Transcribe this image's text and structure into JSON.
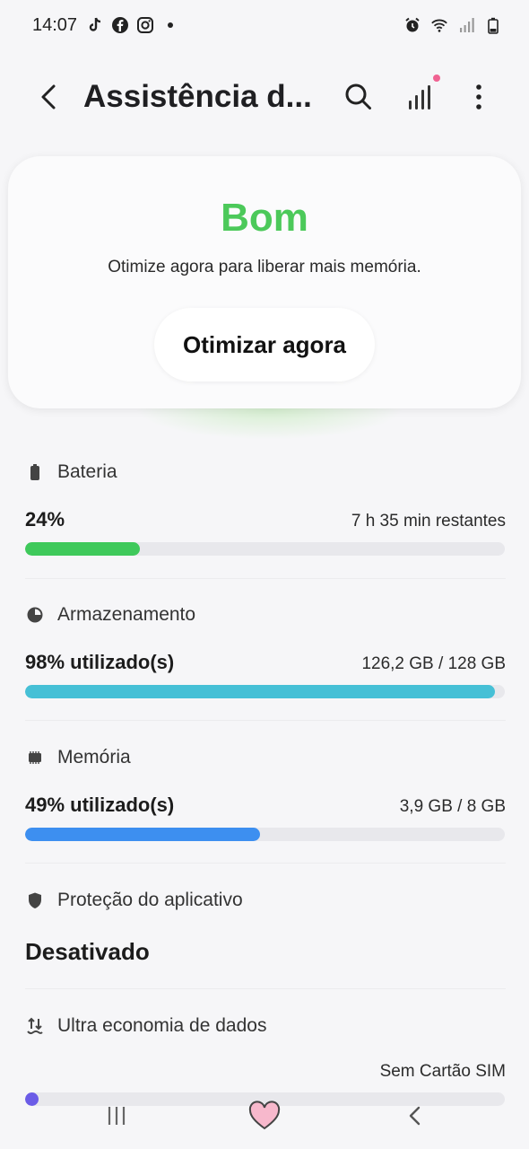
{
  "status_bar": {
    "time": "14:07"
  },
  "app_bar": {
    "title": "Assistência d..."
  },
  "status_card": {
    "status_word": "Bom",
    "description": "Otimize agora para liberar mais memória.",
    "button_label": "Otimizar agora"
  },
  "battery": {
    "label": "Bateria",
    "value": "24%",
    "detail": "7 h 35 min restantes",
    "fill_fraction": 0.24,
    "bar_color": "#3fc95b"
  },
  "storage": {
    "label": "Armazenamento",
    "value": "98% utilizado(s)",
    "detail": "126,2 GB / 128 GB",
    "fill_fraction": 0.98,
    "bar_color": "#46c0d6"
  },
  "memory": {
    "label": "Memória",
    "value": "49% utilizado(s)",
    "detail": "3,9 GB / 8 GB",
    "fill_fraction": 0.49,
    "bar_color": "#3d8ff0"
  },
  "app_protection": {
    "label": "Proteção do aplicativo",
    "value": "Desativado"
  },
  "ultra_data_saving": {
    "label": "Ultra economia de dados",
    "detail": "Sem Cartão SIM",
    "bar_color": "#6b5ce7"
  },
  "icons": {
    "status_left": [
      "tiktok-icon",
      "facebook-icon",
      "instagram-icon",
      "dot-icon"
    ],
    "status_right": [
      "alarm-icon",
      "wifi-icon",
      "signal-icon",
      "battery-icon"
    ],
    "app_bar": [
      "back-icon",
      "search-icon",
      "signal-bars-icon",
      "more-icon"
    ],
    "nav": [
      "recent-apps-icon",
      "home-heart-icon",
      "back-nav-icon"
    ]
  }
}
